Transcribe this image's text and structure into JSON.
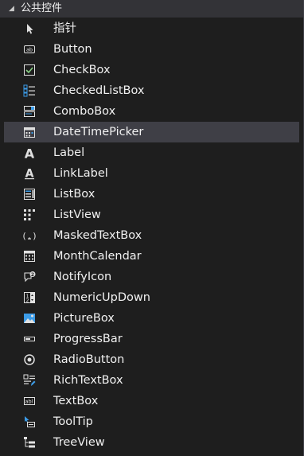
{
  "toolbox": {
    "group_title": "公共控件",
    "items": [
      {
        "label": "指针",
        "icon": "pointer-icon"
      },
      {
        "label": "Button",
        "icon": "button-icon"
      },
      {
        "label": "CheckBox",
        "icon": "checkbox-icon"
      },
      {
        "label": "CheckedListBox",
        "icon": "checked-list-box-icon"
      },
      {
        "label": "ComboBox",
        "icon": "combobox-icon"
      },
      {
        "label": "DateTimePicker",
        "icon": "datetime-picker-icon",
        "selected": true
      },
      {
        "label": "Label",
        "icon": "label-icon"
      },
      {
        "label": "LinkLabel",
        "icon": "link-label-icon"
      },
      {
        "label": "ListBox",
        "icon": "listbox-icon"
      },
      {
        "label": "ListView",
        "icon": "listview-icon"
      },
      {
        "label": "MaskedTextBox",
        "icon": "masked-textbox-icon"
      },
      {
        "label": "MonthCalendar",
        "icon": "month-calendar-icon"
      },
      {
        "label": "NotifyIcon",
        "icon": "notify-icon-icon"
      },
      {
        "label": "NumericUpDown",
        "icon": "numeric-updown-icon"
      },
      {
        "label": "PictureBox",
        "icon": "picture-box-icon"
      },
      {
        "label": "ProgressBar",
        "icon": "progress-bar-icon"
      },
      {
        "label": "RadioButton",
        "icon": "radio-button-icon"
      },
      {
        "label": "RichTextBox",
        "icon": "rich-textbox-icon"
      },
      {
        "label": "TextBox",
        "icon": "textbox-icon"
      },
      {
        "label": "ToolTip",
        "icon": "tooltip-icon"
      },
      {
        "label": "TreeView",
        "icon": "treeview-icon"
      }
    ]
  },
  "colors": {
    "background": "#1e1e1e",
    "header_background": "#333337",
    "selected_background": "#3f3f46",
    "text": "#f1f1f1",
    "icon_light": "#e0e0e0",
    "icon_blue": "#3c9ce8",
    "icon_green": "#89d185"
  }
}
